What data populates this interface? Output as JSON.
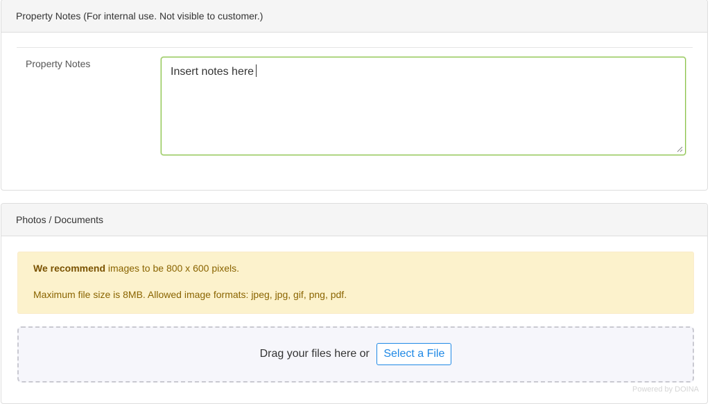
{
  "notes_section": {
    "header": "Property Notes (For internal use. Not visible to customer.)",
    "label": "Property Notes",
    "value": "Insert notes here"
  },
  "photos_section": {
    "header": "Photos / Documents",
    "recommend_strong": "We recommend",
    "recommend_rest": " images to be 800 x 600 pixels.",
    "limits": "Maximum file size is 8MB. Allowed image formats: jpeg, jpg, gif, png, pdf.",
    "drop_text": "Drag your files here or",
    "select_button": "Select a File",
    "powered_by": "Powered by DOINA"
  },
  "colors": {
    "focus_border": "#8bc34a",
    "alert_bg": "#fcf2cc",
    "alert_text": "#8a6400",
    "link_blue": "#1e88e5"
  }
}
